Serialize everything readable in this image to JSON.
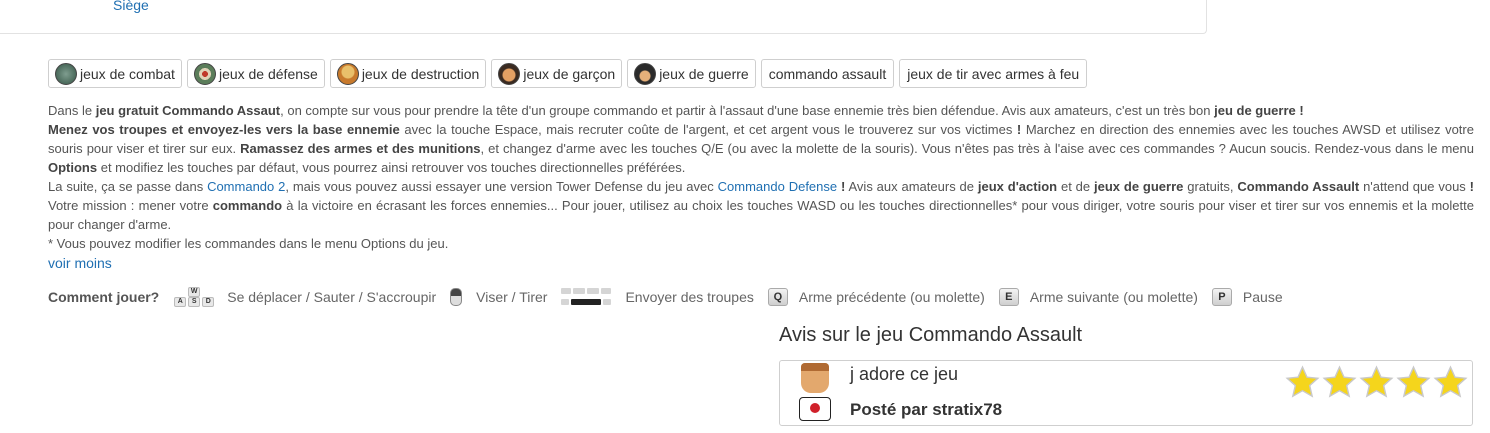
{
  "top": {
    "link_label": "Siège"
  },
  "tags": [
    {
      "label": "jeux de combat",
      "icon": "combat-badge-icon"
    },
    {
      "label": "jeux de défense",
      "icon": "defense-badge-icon"
    },
    {
      "label": "jeux de destruction",
      "icon": "destruction-badge-icon"
    },
    {
      "label": "jeux de garçon",
      "icon": "boy-badge-icon"
    },
    {
      "label": "jeux de guerre",
      "icon": "war-badge-icon"
    },
    {
      "label": "commando assault"
    },
    {
      "label": "jeux de tir avec armes à feu"
    }
  ],
  "description": {
    "p1": {
      "t1": "Dans le ",
      "b1": "jeu gratuit Commando Assaut",
      "t2": ", on compte sur vous pour prendre la tête d'un groupe commando et partir à l'assaut d'une base ennemie très bien défendue. Avis aux amateurs, c'est un très bon ",
      "b2": "jeu de guerre !"
    },
    "p2": {
      "b1": "Menez vos troupes et envoyez-les vers la base ennemie",
      "t1": " avec la touche Espace, mais recruter coûte de l'argent, et cet argent vous le trouverez sur vos victimes ",
      "b2": "!",
      "t2": " Marchez en direction des ennemies avec les touches AWSD et utilisez votre souris pour viser et tirer sur eux. ",
      "b3": "Ramassez des armes et des munitions",
      "t3": ", et changez d'arme avec les touches Q/E (ou avec la molette de la souris). Vous n'êtes pas très à l'aise avec ces commandes ? Aucun soucis. Rendez-vous dans le menu ",
      "b4": "Options",
      "t4": " et modifiez les touches par défaut, vous pourrez ainsi retrouver vos touches directionnelles préférées."
    },
    "p3": {
      "t1": "La suite, ça se passe dans ",
      "a1": "Commando 2",
      "t2": ", mais vous pouvez aussi essayer une version Tower Defense du jeu avec ",
      "a2": "Commando Defense",
      "t3": " ",
      "b1": "!",
      "t4": " Avis aux amateurs de ",
      "b2": "jeux d'action",
      "t5": " et de ",
      "b3": "jeux de guerre",
      "t6": " gratuits, ",
      "b4": "Commando Assault",
      "t7": " n'attend que vous ",
      "b5": "!",
      "t8": " Votre mission : mener votre ",
      "b6": "commando",
      "t9": " à la victoire en écrasant les forces ennemies... Pour jouer, utilisez au choix les touches WASD ou les touches directionnelles* pour vous diriger, votre souris pour viser et tirer sur vos ennemis et la molette pour changer d'arme."
    },
    "p4": "* Vous pouvez modifier les commandes dans le menu Options du jeu.",
    "more_link": "voir moins"
  },
  "controls": {
    "label": "Comment jouer?",
    "items": [
      {
        "icon": "wasd-keys-icon",
        "text": "Se déplacer / Sauter / S'accroupir"
      },
      {
        "icon": "mouse-icon",
        "text": "Viser / Tirer"
      },
      {
        "icon": "spacebar-keyboard-icon",
        "text": "Envoyer des troupes"
      },
      {
        "icon": "q-key-icon",
        "key": "Q",
        "text": "Arme précédente (ou molette)"
      },
      {
        "icon": "e-key-icon",
        "key": "E",
        "text": "Arme suivante (ou molette)"
      },
      {
        "icon": "p-key-icon",
        "key": "P",
        "text": "Pause"
      }
    ],
    "wasd_keys": {
      "w": "W",
      "a": "A",
      "s": "S",
      "d": "D"
    }
  },
  "reviews": {
    "title": "Avis sur le jeu Commando Assault",
    "items": [
      {
        "text": "j adore ce jeu",
        "author": "Posté par stratix78",
        "rating": 5,
        "max_rating": 5
      }
    ]
  },
  "colors": {
    "link": "#1f6fb2",
    "star": "#f5d51c",
    "border": "#cfcfcf"
  }
}
